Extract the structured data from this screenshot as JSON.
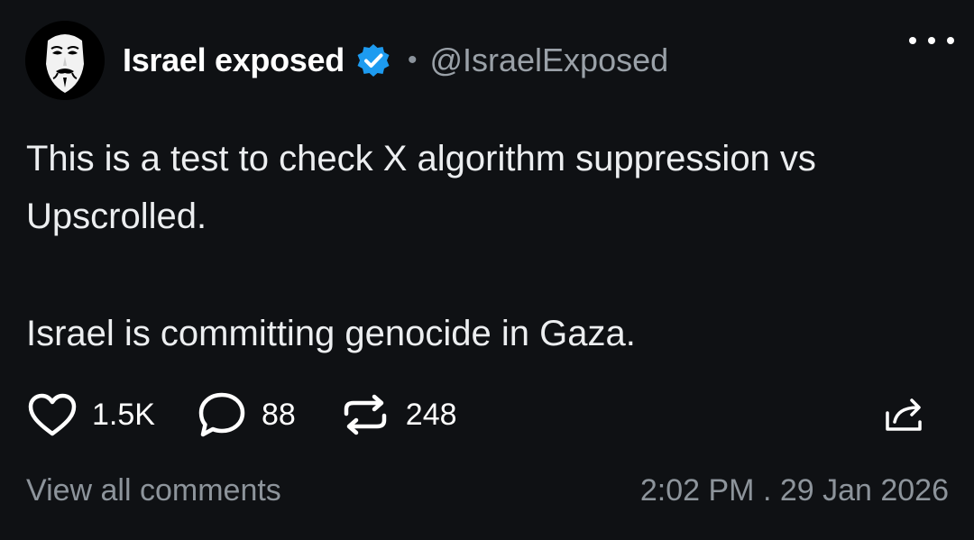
{
  "author": {
    "name": "Israel exposed",
    "separator": "•",
    "handle": "@IsraelExposed",
    "avatar_icon": "anonymous-mask-icon",
    "verified_icon": "verified-badge-icon",
    "verified_color": "#1d9bf0"
  },
  "post": {
    "line1": "This is a test to check X algorithm suppression vs Upscrolled.",
    "line2": "Israel is committing genocide in Gaza."
  },
  "actions": {
    "likes": "1.5K",
    "comments": "88",
    "reposts": "248",
    "like_icon": "heart-icon",
    "comment_icon": "comment-bubble-icon",
    "repost_icon": "repost-icon",
    "share_icon": "share-icon",
    "more_icon": "more-options-icon"
  },
  "footer": {
    "view_all": "View all comments",
    "timestamp": "2:02 PM . 29 Jan 2026"
  },
  "colors": {
    "background": "#0f1114",
    "text": "#e8eaed",
    "muted": "#8d949b"
  }
}
